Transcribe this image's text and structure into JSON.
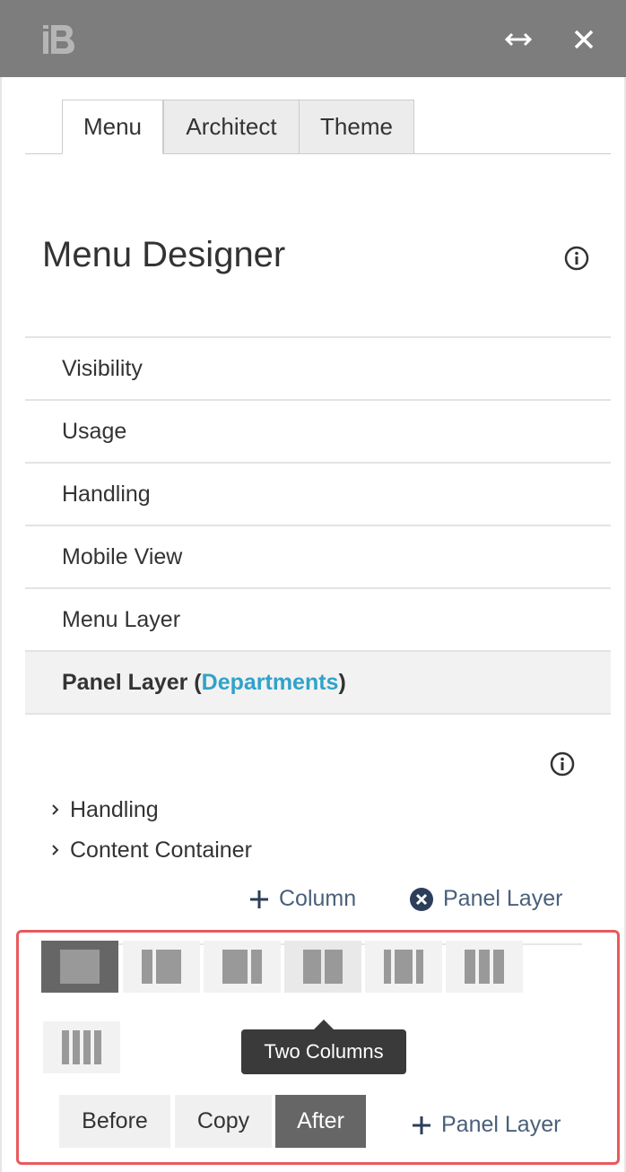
{
  "header": {
    "logo_icon": "ib-logo",
    "expand_icon": "horizontal-arrows-icon",
    "close_icon": "close-icon"
  },
  "tabs": [
    {
      "label": "Menu",
      "active": true
    },
    {
      "label": "Architect",
      "active": false
    },
    {
      "label": "Theme",
      "active": false
    }
  ],
  "title": "Menu Designer",
  "menu_items": [
    {
      "label": "Visibility"
    },
    {
      "label": "Usage"
    },
    {
      "label": "Handling"
    },
    {
      "label": "Mobile View"
    },
    {
      "label": "Menu Layer"
    }
  ],
  "active_item": {
    "prefix": "Panel Layer (",
    "highlight": "Departments",
    "suffix": ")"
  },
  "tree": [
    {
      "label": "Handling"
    },
    {
      "label": "Content Container"
    }
  ],
  "actions": {
    "add_column": "Column",
    "remove_panel_layer": "Panel Layer",
    "add_panel_layer": "Panel Layer"
  },
  "tooltip": "Two Columns",
  "position_buttons": [
    {
      "label": "Before",
      "active": false
    },
    {
      "label": "Copy",
      "active": false
    },
    {
      "label": "After",
      "active": true
    }
  ],
  "colors": {
    "header_bg": "#7d7d7d",
    "accent_link": "#2fa3c9",
    "highlight_border": "#e9595d",
    "action_text": "#4a5f7a"
  }
}
